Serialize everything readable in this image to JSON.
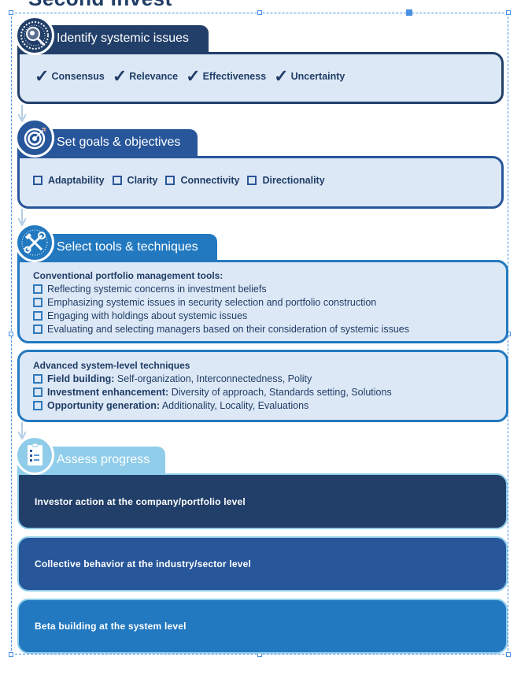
{
  "page": {
    "heading_clipped": "Second Invest"
  },
  "colors": {
    "navy": "#213f69",
    "blue": "#27569a",
    "mid_blue": "#2279c0",
    "light_blue": "#8fcdea",
    "panel_bg": "#dde8f6",
    "text_dark": "#1f3d66",
    "selection": "#4a90e2"
  },
  "sections": [
    {
      "title": "Identify systemic issues",
      "icon": "magnifier-icon",
      "items": [
        "Consensus",
        "Relevance",
        "Effectiveness",
        "Uncertainty"
      ],
      "marker": "✓"
    },
    {
      "title": "Set goals & objectives",
      "icon": "target-icon",
      "items": [
        "Adaptability",
        "Clarity",
        "Connectivity",
        "Directionality"
      ]
    },
    {
      "title": "Select tools & techniques",
      "icon": "tools-icon",
      "groups": [
        {
          "title": "Conventional portfolio management tools:",
          "items": [
            "Reflecting systemic concerns in investment beliefs",
            "Emphasizing systemic issues in security selection and portfolio construction",
            "Engaging with holdings about systemic issues",
            "Evaluating and selecting managers based on their consideration of systemic issues"
          ]
        },
        {
          "title": "Advanced system-level techniques",
          "items": [
            {
              "label": "Field building:",
              "detail": " Self-organization, Interconnectedness, Polity"
            },
            {
              "label": "Investment enhancement:",
              "detail": " Diversity of approach, Standards setting, Solutions"
            },
            {
              "label": "Opportunity generation:",
              "detail": " Additionality, Locality, Evaluations"
            }
          ]
        }
      ]
    },
    {
      "title": "Assess progress",
      "icon": "checklist-icon",
      "levels": [
        "Investor action at the company/portfolio level",
        "Collective behavior at the industry/sector level",
        "Beta building at the system level"
      ]
    }
  ]
}
